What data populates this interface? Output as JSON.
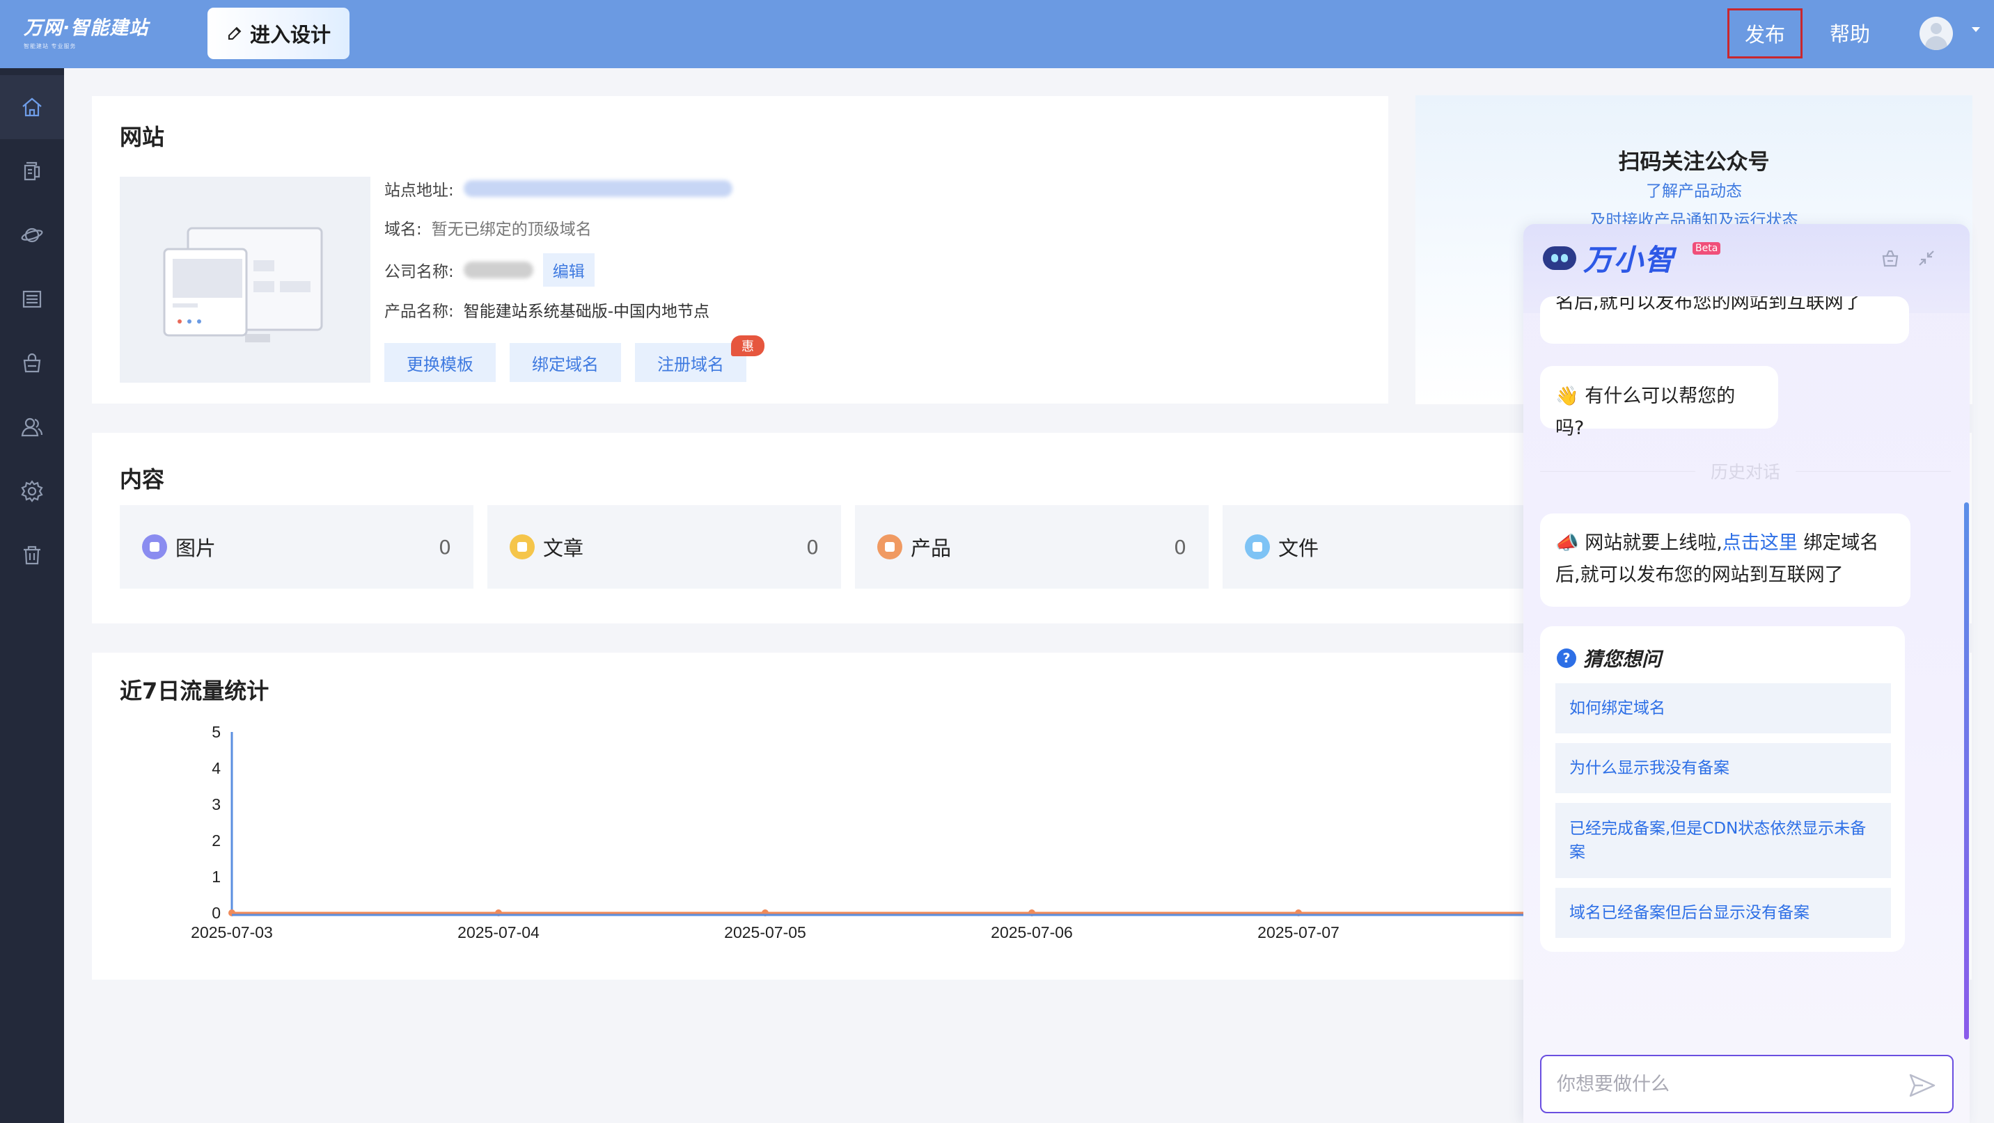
{
  "header": {
    "logo_main": "万网·智能建站",
    "logo_sub": "智能建站 专业服务",
    "design_button": "进入设计",
    "publish_button": "发布",
    "help_button": "帮助"
  },
  "sidebar": {
    "items": [
      {
        "icon": "home-icon"
      },
      {
        "icon": "pages-icon"
      },
      {
        "icon": "planet-icon"
      },
      {
        "icon": "list-icon"
      },
      {
        "icon": "shop-bag-icon"
      },
      {
        "icon": "users-icon"
      },
      {
        "icon": "settings-icon"
      },
      {
        "icon": "trash-icon"
      }
    ]
  },
  "website": {
    "title": "网站",
    "site_address_label": "站点地址:",
    "domain_label": "域名:",
    "domain_value": "暂无已绑定的顶级域名",
    "company_label": "公司名称:",
    "edit_button": "编辑",
    "product_label": "产品名称:",
    "product_value": "智能建站系统基础版-中国内地节点",
    "buttons": {
      "change_template": "更换模板",
      "bind_domain": "绑定域名",
      "register_domain": "注册域名"
    },
    "promo_badge": "惠"
  },
  "content": {
    "title": "内容",
    "stats": [
      {
        "label": "图片",
        "count": "0",
        "color": "#8a8cf0"
      },
      {
        "label": "文章",
        "count": "0",
        "color": "#f5c54a"
      },
      {
        "label": "产品",
        "count": "0",
        "color": "#f09a62"
      },
      {
        "label": "文件",
        "count": "",
        "color": "#7ec3f5"
      }
    ]
  },
  "traffic": {
    "title": "近7日流量统计"
  },
  "chart_data": {
    "type": "line",
    "x": [
      "2025-07-03",
      "2025-07-04",
      "2025-07-05",
      "2025-07-06",
      "2025-07-07"
    ],
    "series": [
      {
        "values": [
          0,
          0,
          0,
          0,
          0
        ],
        "color": "#ef8a5a"
      },
      {
        "values": [
          0,
          0,
          0,
          0,
          0
        ],
        "color": "#5b8fe0"
      }
    ],
    "yticks": [
      0,
      1,
      2,
      3,
      4,
      5
    ],
    "ylim": [
      0,
      5
    ]
  },
  "qr": {
    "title": "扫码关注公众号",
    "line1": "了解产品动态",
    "line2": "及时接收产品通知及运行状态"
  },
  "chat": {
    "title": "万小智",
    "beta": "Beta",
    "partial_message": "名后,就可以发布您的网站到互联网了",
    "greeting": "👋 有什么可以帮您的吗?",
    "history_label": "历史对话",
    "msg_prefix": "📣 网站就要上线啦,",
    "msg_link": "点击这里",
    "msg_suffix": "绑定域名后,就可以发布您的网站到互联网了",
    "guess_title": "猜您想问",
    "questions": [
      "如何绑定域名",
      "为什么显示我没有备案",
      "已经完成备案,但是CDN状态依然显示未备案",
      "域名已经备案但后台显示没有备案"
    ],
    "input_placeholder": "你想要做什么"
  }
}
